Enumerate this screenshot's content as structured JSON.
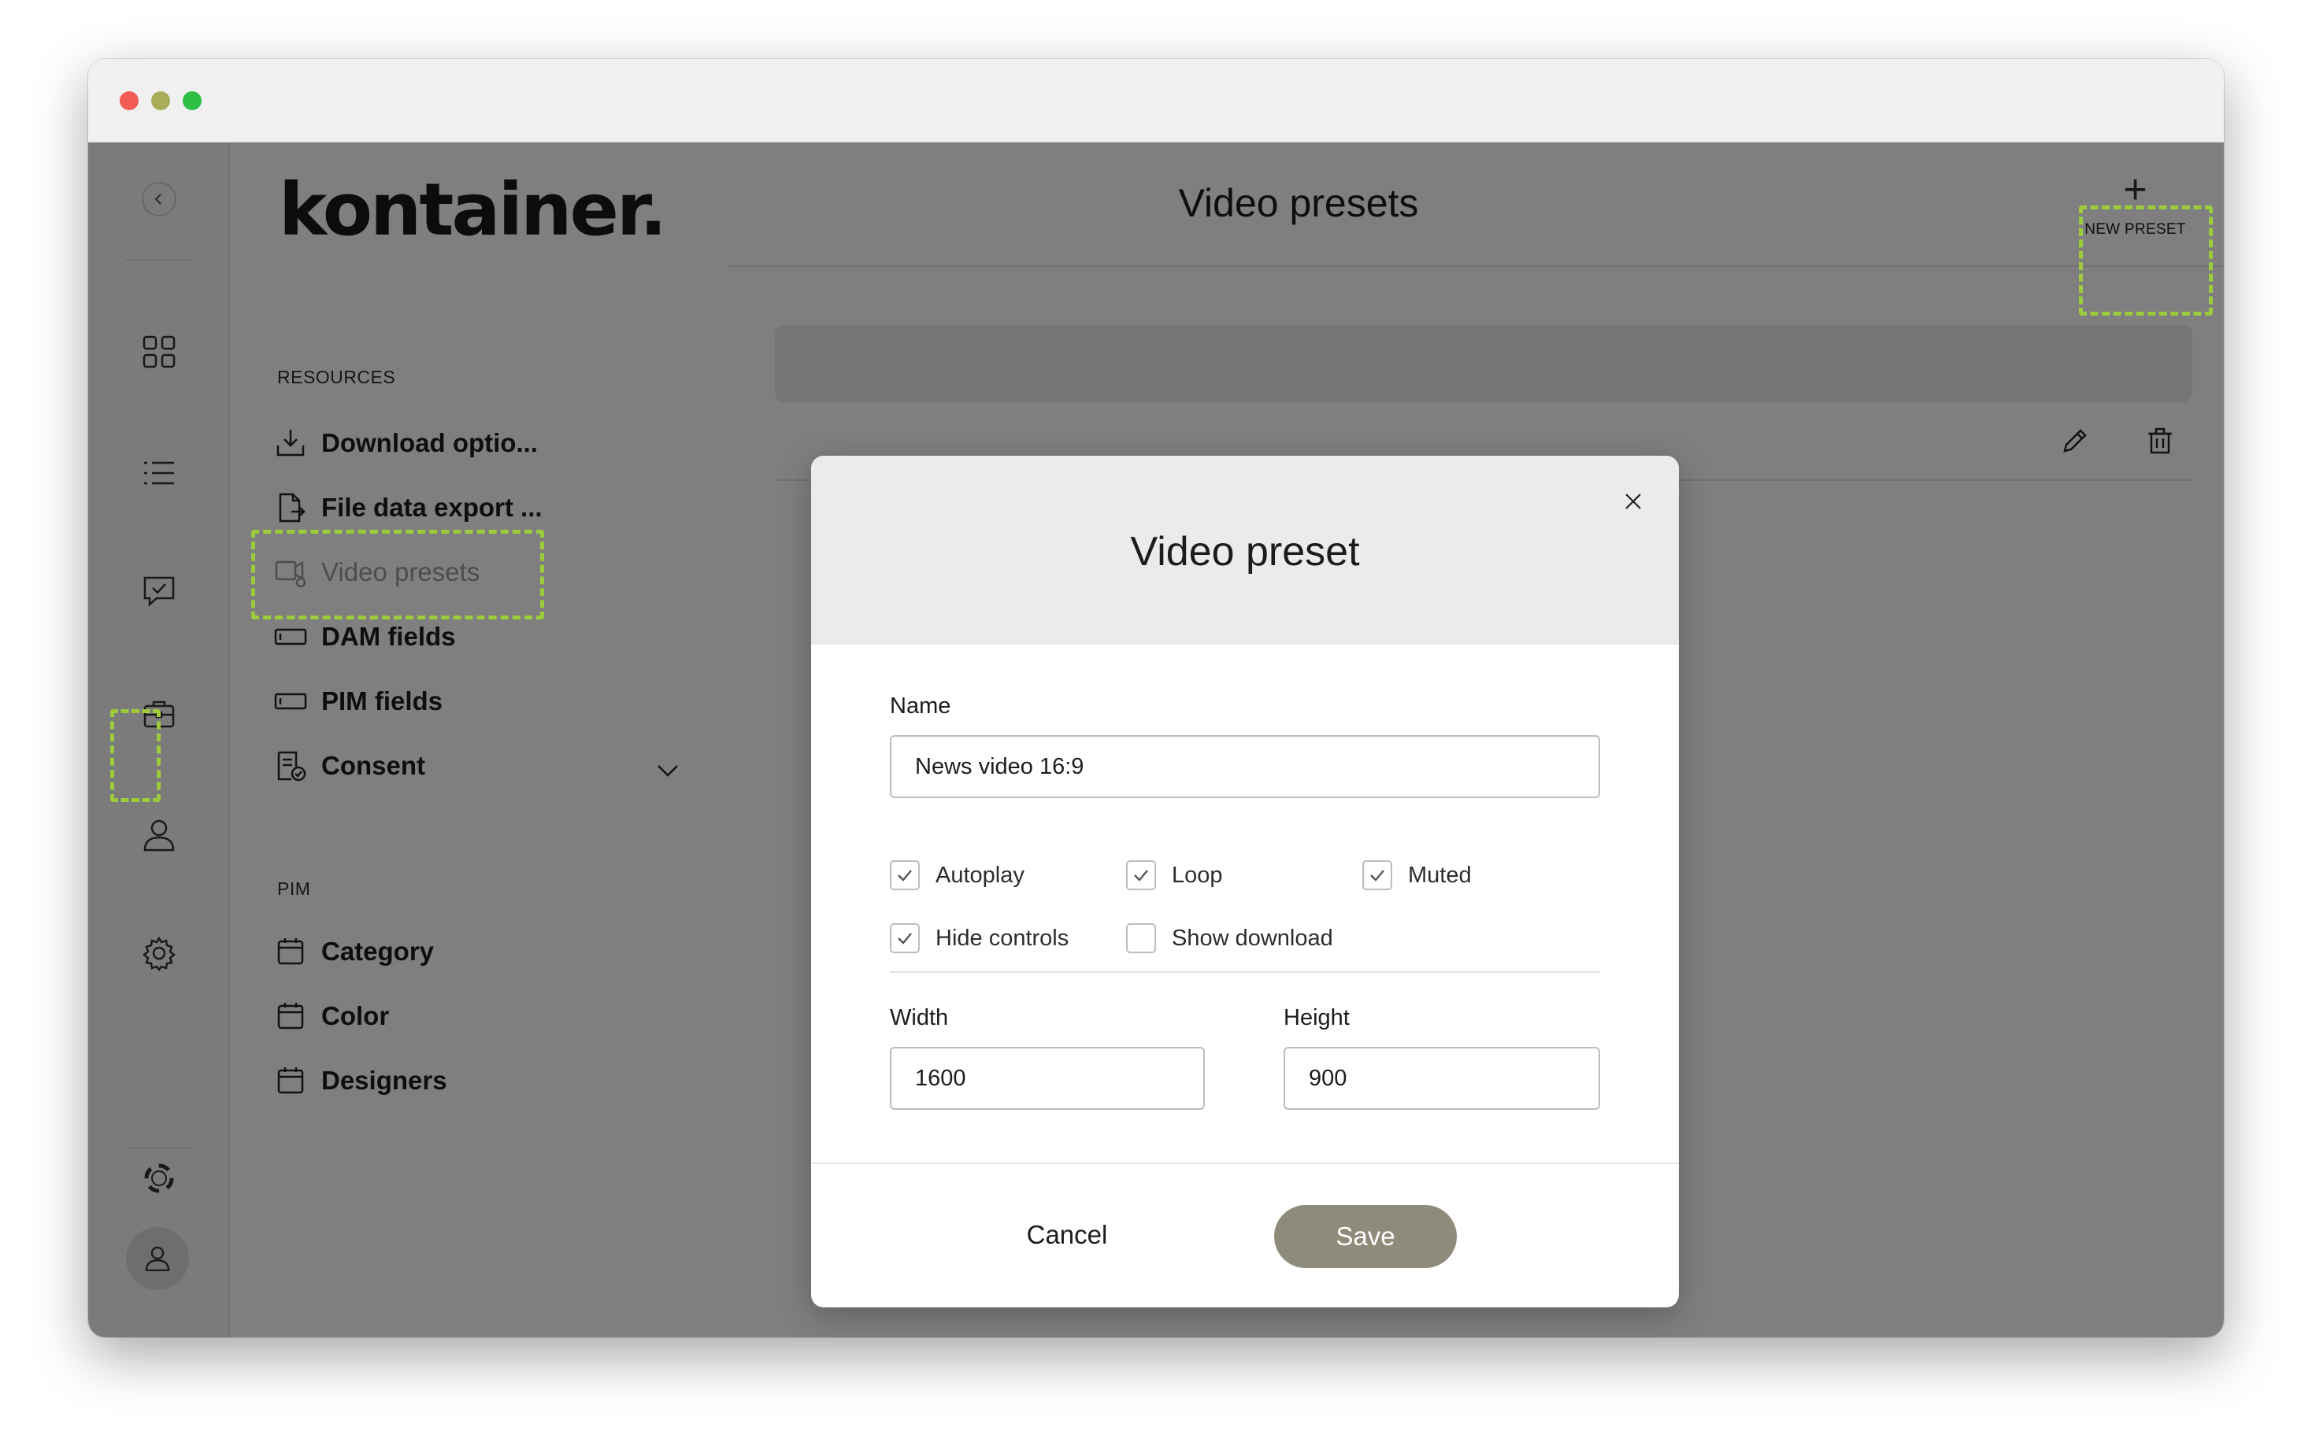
{
  "app": {
    "logo": "kontainer.",
    "page_title": "Video presets",
    "new_preset_label": "NEW PRESET"
  },
  "nav": {
    "resources_heading": "RESOURCES",
    "resources": [
      {
        "label": "Download optio...",
        "icon": "download-icon"
      },
      {
        "label": "File data export ...",
        "icon": "file-export-icon"
      },
      {
        "label": "Video presets",
        "icon": "video-settings-icon",
        "active": true
      },
      {
        "label": "DAM fields",
        "icon": "field-icon"
      },
      {
        "label": "PIM fields",
        "icon": "field-icon"
      },
      {
        "label": "Consent",
        "icon": "consent-icon"
      }
    ],
    "pim_heading": "PIM",
    "pim": [
      {
        "label": "Category",
        "icon": "calendar-icon"
      },
      {
        "label": "Color",
        "icon": "calendar-icon"
      },
      {
        "label": "Designers",
        "icon": "calendar-icon"
      }
    ]
  },
  "modal": {
    "title": "Video preset",
    "name_label": "Name",
    "name_value": "News video 16:9",
    "checkboxes": [
      {
        "label": "Autoplay",
        "checked": true
      },
      {
        "label": "Loop",
        "checked": true
      },
      {
        "label": "Muted",
        "checked": true
      },
      {
        "label": "Hide controls",
        "checked": true
      },
      {
        "label": "Show download",
        "checked": false
      }
    ],
    "width_label": "Width",
    "width_value": "1600",
    "height_label": "Height",
    "height_value": "900",
    "cancel_label": "Cancel",
    "save_label": "Save"
  },
  "colors": {
    "save_button": "#8e8b7a",
    "highlight": "#9ccc3c",
    "overlay": "rgba(0,0,0,0.5)"
  }
}
